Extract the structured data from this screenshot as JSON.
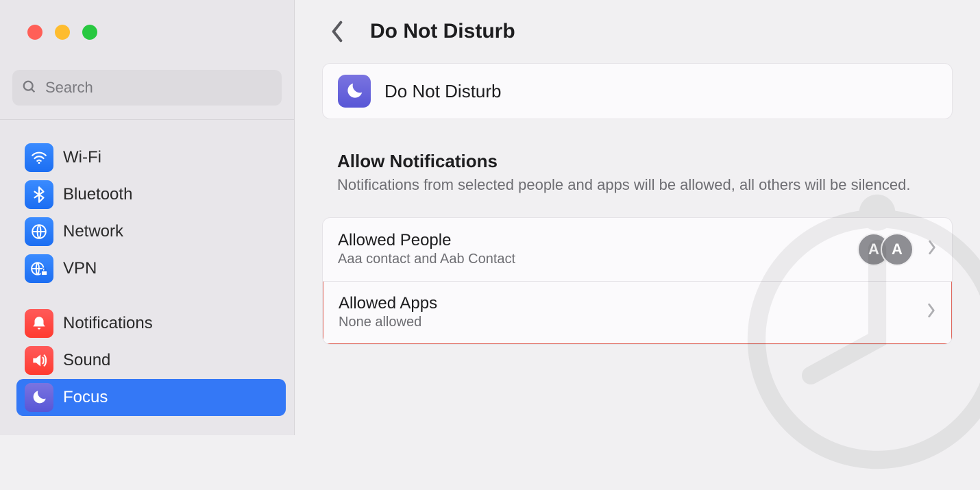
{
  "search": {
    "placeholder": "Search"
  },
  "sidebar": {
    "group1": [
      {
        "label": "Wi-Fi"
      },
      {
        "label": "Bluetooth"
      },
      {
        "label": "Network"
      },
      {
        "label": "VPN"
      }
    ],
    "group2": [
      {
        "label": "Notifications"
      },
      {
        "label": "Sound"
      },
      {
        "label": "Focus"
      }
    ]
  },
  "header": {
    "title": "Do Not Disturb"
  },
  "dndCard": {
    "label": "Do Not Disturb"
  },
  "allowSection": {
    "title": "Allow Notifications",
    "subtitle": "Notifications from selected people and apps will be allowed, all others will be silenced."
  },
  "rows": {
    "people": {
      "title": "Allowed People",
      "subtitle": "Aaa contact and Aab Contact",
      "avatars": [
        "A",
        "A"
      ]
    },
    "apps": {
      "title": "Allowed Apps",
      "subtitle": "None allowed"
    }
  }
}
